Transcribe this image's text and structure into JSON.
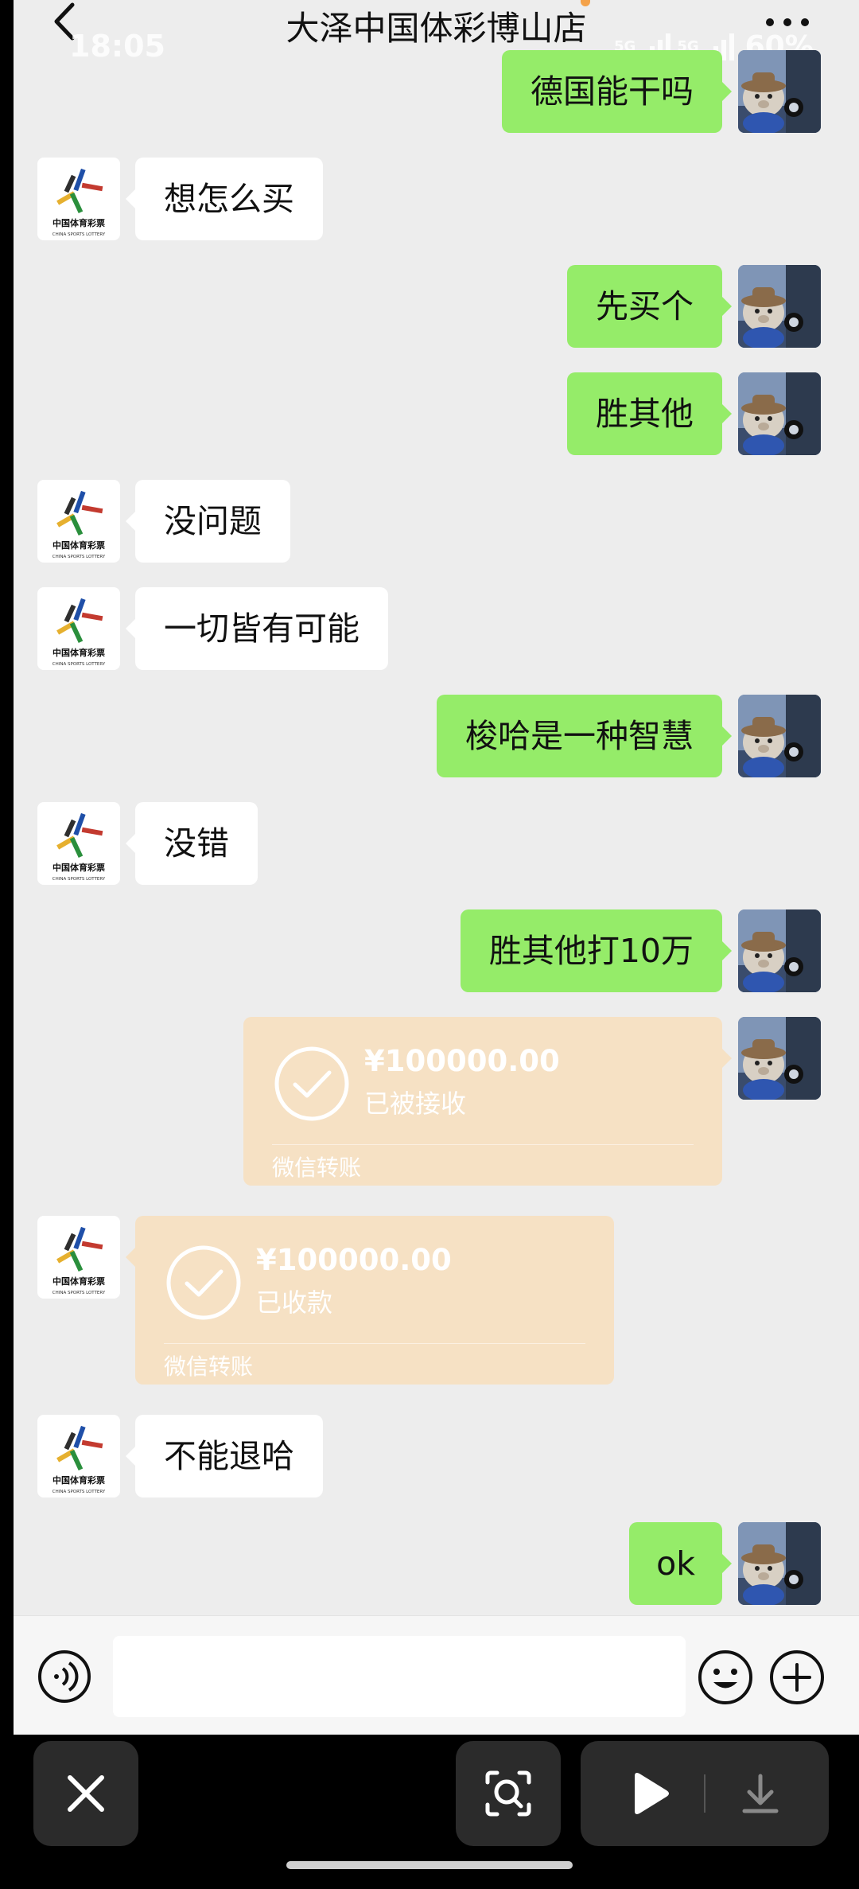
{
  "header": {
    "title": "大泽中国体彩博山店",
    "time": "18:05",
    "battery": "60%",
    "signal_label_1": "5G",
    "signal_label_2": "5G"
  },
  "shop_logo": {
    "line1": "中国体育彩票",
    "line2": "CHINA SPORTS LOTTERY"
  },
  "messages": [
    {
      "side": "right",
      "text": "德国能干吗"
    },
    {
      "side": "left",
      "text": "想怎么买"
    },
    {
      "side": "right",
      "text": "先买个"
    },
    {
      "side": "right",
      "text": "胜其他"
    },
    {
      "side": "left",
      "text": "没问题"
    },
    {
      "side": "left",
      "text": "一切皆有可能"
    },
    {
      "side": "right",
      "text": "梭哈是一种智慧"
    },
    {
      "side": "left",
      "text": "没错"
    },
    {
      "side": "right",
      "text": "胜其他打10万"
    },
    {
      "side": "right",
      "type": "transfer",
      "amount": "¥100000.00",
      "status": "已被接收",
      "brand": "微信转账"
    },
    {
      "side": "left",
      "type": "transfer",
      "amount": "¥100000.00",
      "status": "已收款",
      "brand": "微信转账"
    },
    {
      "side": "left",
      "text": "不能退哈"
    },
    {
      "side": "right",
      "text": "ok"
    }
  ],
  "colors": {
    "chat_bg": "#ededed",
    "bubble_self": "#95ec69",
    "bubble_other": "#ffffff",
    "transfer_card": "#f6e1c4"
  }
}
